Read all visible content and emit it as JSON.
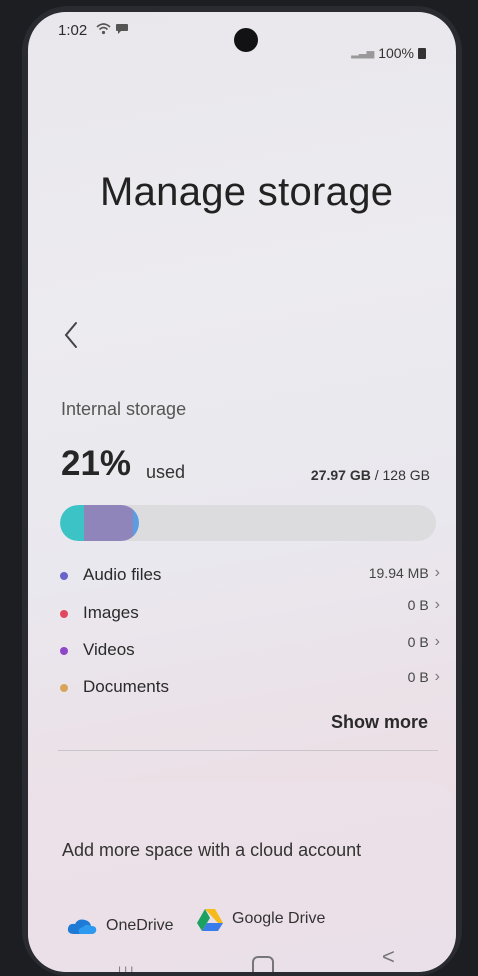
{
  "status_bar": {
    "time": "1:02",
    "battery": "100%",
    "icons": [
      "wifi-icon",
      "chat-icon",
      "signal-icon",
      "battery-icon"
    ]
  },
  "page": {
    "title": "Manage storage",
    "back_icon": "chevron-left-icon"
  },
  "storage": {
    "label": "Internal storage",
    "percent": "21%",
    "used_word": "used",
    "used_amount": "27.97 GB",
    "separator": " / ",
    "total": "128 GB",
    "usage_fraction": 0.21,
    "bar_colors": [
      "#3cc3c6",
      "#8f85bb",
      "#5a9de0"
    ],
    "empty_color": "#dcdcdf"
  },
  "categories": [
    {
      "label": "Audio files",
      "size": "19.94 MB",
      "color": "#6a63c9"
    },
    {
      "label": "Images",
      "size": "0 B",
      "color": "#e2485e"
    },
    {
      "label": "Videos",
      "size": "0 B",
      "color": "#8d47c8"
    },
    {
      "label": "Documents",
      "size": "0 B",
      "color": "#d9a45a"
    }
  ],
  "show_more": "Show more",
  "cloud": {
    "title": "Add more space with a cloud account",
    "accounts": [
      {
        "label": "OneDrive",
        "icon": "onedrive-icon"
      },
      {
        "label": "Google Drive",
        "icon": "google-drive-icon"
      }
    ]
  },
  "nav": {
    "recent": "|||",
    "back": "<"
  }
}
